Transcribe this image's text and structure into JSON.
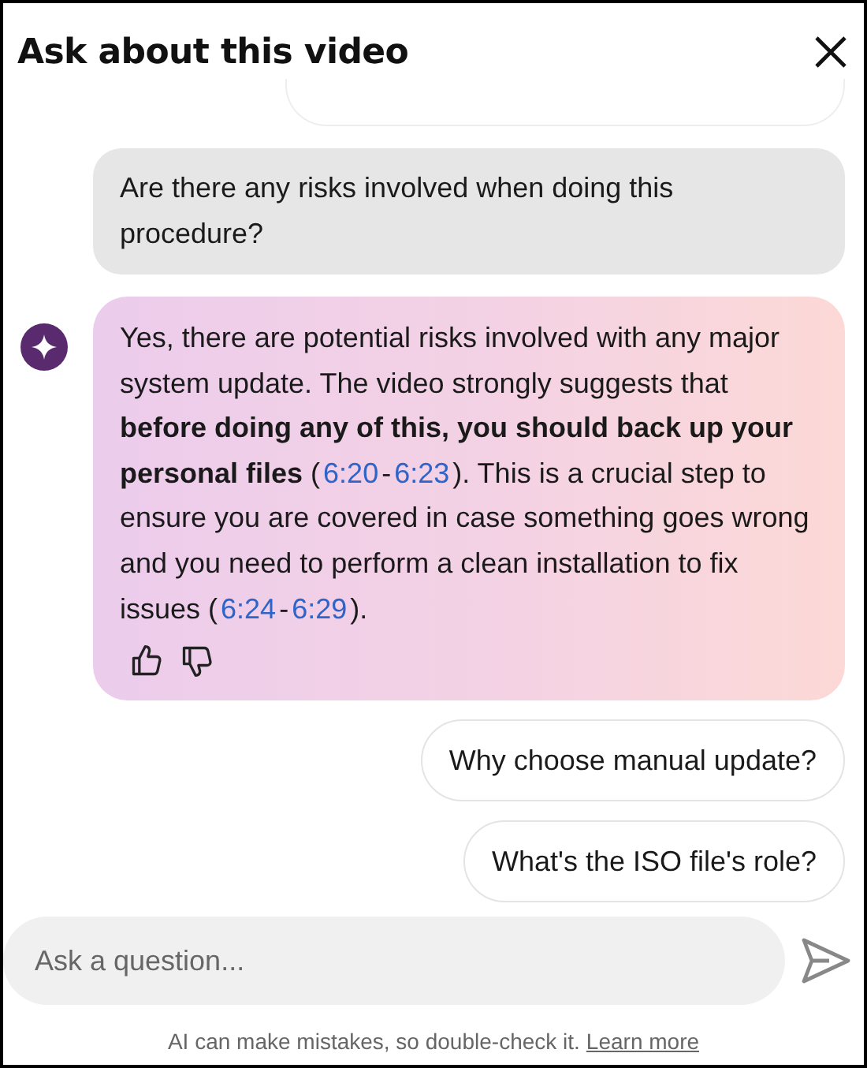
{
  "header": {
    "title": "Ask about this video"
  },
  "messages": [
    {
      "kind": "user",
      "text": "Are there any risks involved when doing this procedure?"
    },
    {
      "kind": "answer",
      "segments": [
        {
          "kind": "text",
          "text": "Yes, there are potential risks involved with any major system update. The video strongly suggests that **before doing any of this, you should back up your personal files** ("
        },
        {
          "kind": "link",
          "text": "6:20"
        },
        {
          "kind": "text",
          "text": "-"
        },
        {
          "kind": "link",
          "text": "6:23"
        },
        {
          "kind": "text",
          "text": "). This is a crucial step to ensure you are covered in case something goes wrong and you need to perform a clean installation to fix issues ("
        },
        {
          "kind": "link",
          "text": "6:24"
        },
        {
          "kind": "text",
          "text": "-"
        },
        {
          "kind": "link",
          "text": "6:29"
        },
        {
          "kind": "text",
          "text": ")."
        }
      ]
    }
  ],
  "suggestions": [
    "Why choose manual update?",
    "What's the ISO file's role?"
  ],
  "input": {
    "placeholder": "Ask a question..."
  },
  "footer": {
    "note": "AI can make mistakes, so double-check it.",
    "link": "Learn more"
  }
}
